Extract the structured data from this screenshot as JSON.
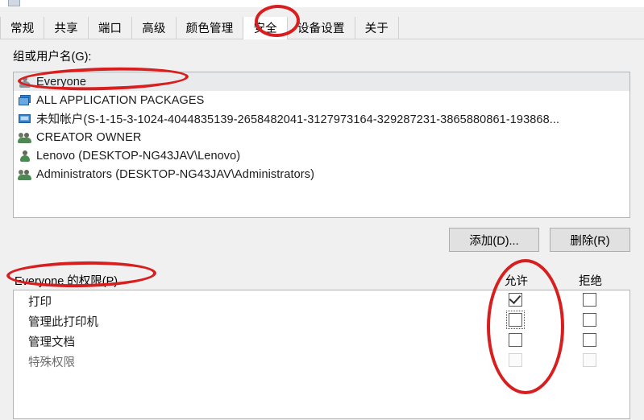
{
  "window": {
    "caption": ""
  },
  "tabs": [
    {
      "label": "常规",
      "selected": false
    },
    {
      "label": "共享",
      "selected": false
    },
    {
      "label": "端口",
      "selected": false
    },
    {
      "label": "高级",
      "selected": false
    },
    {
      "label": "颜色管理",
      "selected": false
    },
    {
      "label": "安全",
      "selected": true
    },
    {
      "label": "设备设置",
      "selected": false
    },
    {
      "label": "关于",
      "selected": false
    }
  ],
  "group_section": {
    "label": "组或用户名(G):",
    "items": [
      {
        "name": "Everyone",
        "icon": "user-grey-icon",
        "selected": true
      },
      {
        "name": "ALL APPLICATION PACKAGES",
        "icon": "packages-icon",
        "selected": false
      },
      {
        "name": "未知帐户(S-1-15-3-1024-4044835139-2658482041-3127973164-329287231-3865880861-193868...",
        "icon": "monitor-icon",
        "selected": false
      },
      {
        "name": "CREATOR OWNER",
        "icon": "group-icon",
        "selected": false
      },
      {
        "name": "Lenovo (DESKTOP-NG43JAV\\Lenovo)",
        "icon": "user-icon",
        "selected": false
      },
      {
        "name": "Administrators (DESKTOP-NG43JAV\\Administrators)",
        "icon": "group-icon",
        "selected": false
      }
    ]
  },
  "buttons": {
    "add": "添加(D)...",
    "remove": "删除(R)"
  },
  "permissions_section": {
    "label": "Everyone 的权限(P)",
    "columns": {
      "allow": "允许",
      "deny": "拒绝"
    },
    "rows": [
      {
        "name": "打印",
        "allow": "checked",
        "deny": "unchecked",
        "focused": false,
        "disabled": false
      },
      {
        "name": "管理此打印机",
        "allow": "unchecked",
        "deny": "unchecked",
        "focused": true,
        "disabled": false
      },
      {
        "name": "管理文档",
        "allow": "unchecked",
        "deny": "unchecked",
        "focused": false,
        "disabled": false
      },
      {
        "name": "特殊权限",
        "allow": "unchecked",
        "deny": "unchecked",
        "focused": false,
        "disabled": true
      }
    ]
  },
  "annotations": {
    "color": "#d81f20",
    "marks": [
      {
        "target": "安全 tab"
      },
      {
        "target": "Everyone 列表项"
      },
      {
        "target": "Everyone 的权限(P) 标签"
      },
      {
        "target": "允许 复选框列"
      }
    ]
  }
}
